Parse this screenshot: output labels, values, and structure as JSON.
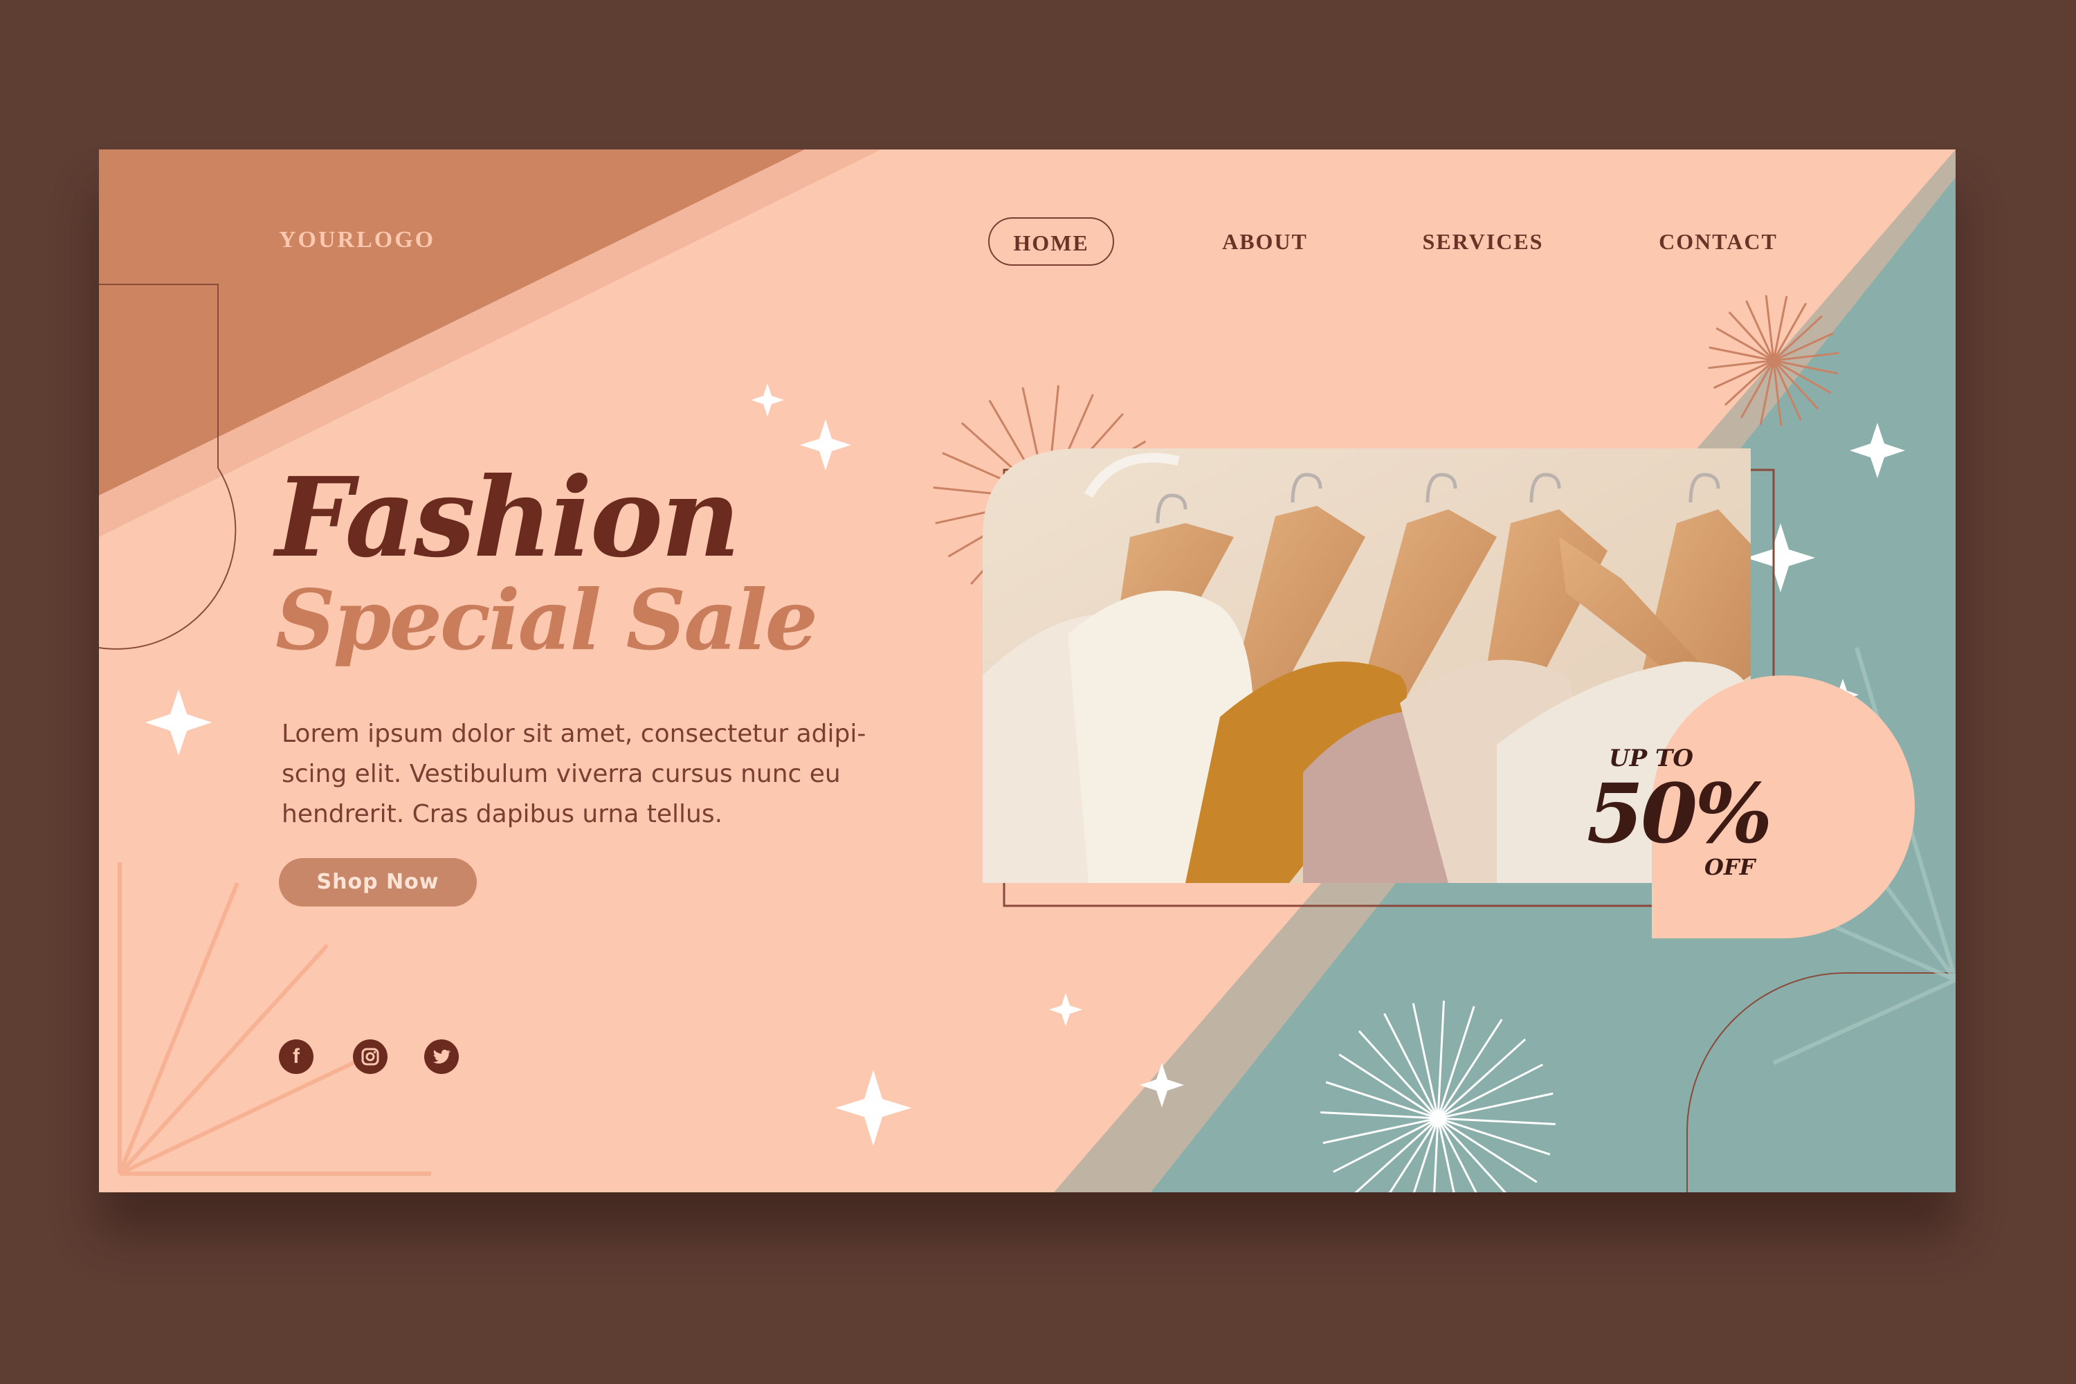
{
  "brand": {
    "logo": "YOURLOGO"
  },
  "nav": {
    "items": [
      {
        "label": "HOME",
        "active": true
      },
      {
        "label": "ABOUT",
        "active": false
      },
      {
        "label": "SERVICES",
        "active": false
      },
      {
        "label": "CONTACT",
        "active": false
      }
    ]
  },
  "hero": {
    "title_line1": "Fashion",
    "title_line2": "Special Sale",
    "description": "Lorem ipsum dolor sit amet, consectetur adipi-scing elit. Vestibulum viverra cursus nunc eu hendrerit. Cras dapibus urna tellus.",
    "cta_label": "Shop Now"
  },
  "promo": {
    "prefix": "UP TO",
    "amount": "50%",
    "suffix": "OFF"
  },
  "social": [
    {
      "icon": "facebook-icon",
      "glyph": "f"
    },
    {
      "icon": "instagram-icon",
      "glyph": "◎"
    },
    {
      "icon": "twitter-icon",
      "glyph": "🐦"
    }
  ],
  "colors": {
    "outer_background": "#5e3d33",
    "peach": "#fdc8b0",
    "terracotta": "#cd8460",
    "teal": "#8aafaa",
    "dark_brown": "#6b2c1f",
    "accent_brown": "#c97d5a"
  }
}
